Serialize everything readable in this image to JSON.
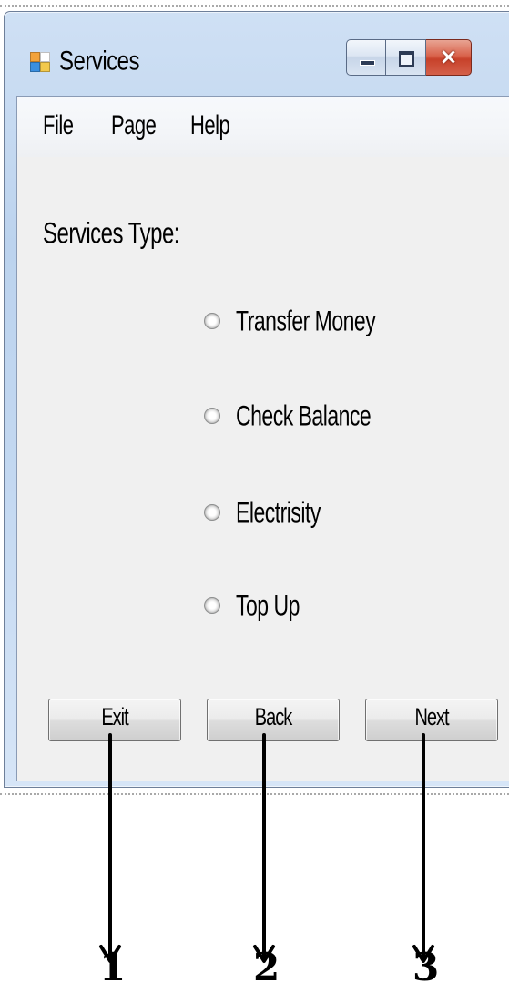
{
  "window": {
    "title": "Services",
    "controls": {
      "minimize": "minimize",
      "maximize": "maximize",
      "close": "×"
    }
  },
  "menu": {
    "items": [
      "File",
      "Page",
      "Help"
    ]
  },
  "form": {
    "group_label": "Services Type:",
    "options": [
      "Transfer Money",
      "Check Balance",
      "Electrisity",
      "Top Up"
    ],
    "selected_option": null
  },
  "buttons": {
    "exit": "Exit",
    "back": "Back",
    "next": "Next"
  },
  "annotations": {
    "labels": [
      "1",
      "2",
      "3"
    ]
  },
  "colors": {
    "client_background": "#f0f0f0",
    "close_button": "#c7412a",
    "frame": "#bcd3ee"
  },
  "icons": {
    "app": "app-window-icon",
    "minimize": "minimize-icon",
    "maximize": "maximize-icon",
    "close": "close-icon"
  }
}
